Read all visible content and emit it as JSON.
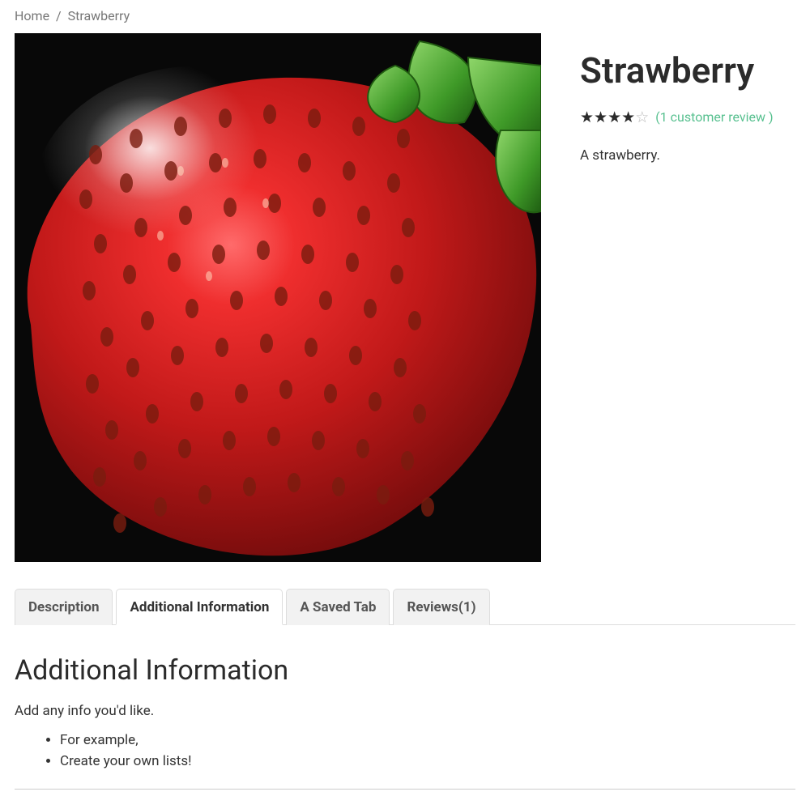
{
  "breadcrumb": {
    "home": "Home",
    "sep": "/",
    "current": "Strawberry"
  },
  "product": {
    "title": "Strawberry",
    "rating": 4,
    "rating_max": 5,
    "review_link": "(1 customer review )",
    "short_desc": "A strawberry."
  },
  "tabs": {
    "items": [
      {
        "label": "Description",
        "active": false
      },
      {
        "label": "Additional Information",
        "active": true
      },
      {
        "label": "A Saved Tab",
        "active": false
      },
      {
        "label": "Reviews(1)",
        "active": false
      }
    ]
  },
  "tab_content": {
    "heading": "Additional Information",
    "paragraph": "Add any info you'd like.",
    "list": [
      "For example,",
      "Create your own lists!"
    ]
  }
}
